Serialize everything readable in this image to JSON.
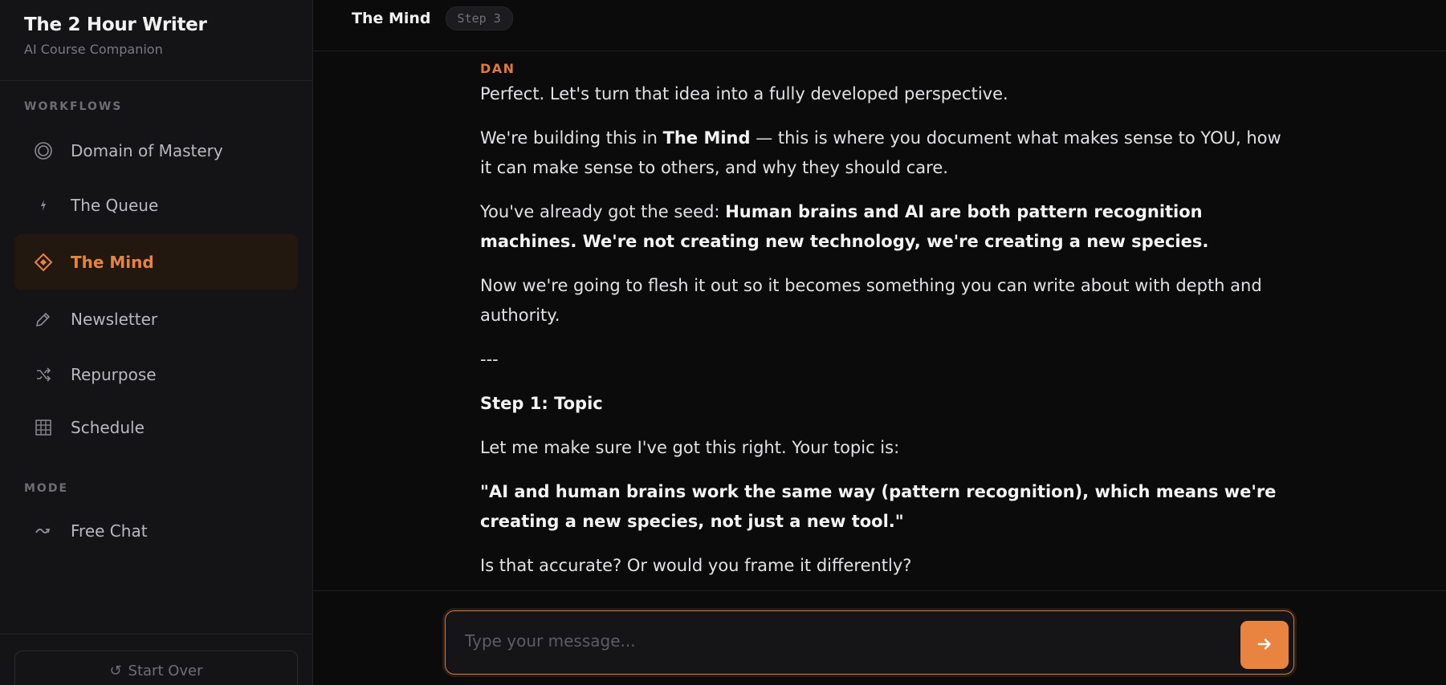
{
  "sidebar": {
    "brand_title": "The 2 Hour Writer",
    "brand_subtitle": "AI Course Companion",
    "workflows_label": "WORKFLOWS",
    "items": [
      {
        "label": "Domain of Mastery",
        "icon": "target-rings-icon"
      },
      {
        "label": "The Queue",
        "icon": "lightning-icon"
      },
      {
        "label": "The Mind",
        "icon": "diamond-icon",
        "active": true
      },
      {
        "label": "Newsletter",
        "icon": "pencil-icon"
      },
      {
        "label": "Repurpose",
        "icon": "shuffle-icon"
      },
      {
        "label": "Schedule",
        "icon": "grid-icon"
      }
    ],
    "mode_label": "MODE",
    "mode_items": [
      {
        "label": "Free Chat",
        "icon": "wave-icon"
      }
    ],
    "start_over": "Start Over"
  },
  "header": {
    "title": "The Mind",
    "step": "Step 3"
  },
  "message": {
    "sender": "DAN",
    "p1": "Perfect. Let's turn that idea into a fully developed perspective.",
    "p2_a": "We're building this in ",
    "p2_b": "The Mind",
    "p2_c": " — this is where you document what makes sense to YOU, how it can make sense to others, and why they should care.",
    "p3_a": "You've already got the seed: ",
    "p3_b": "Human brains and AI are both pattern recognition machines. We're not creating new technology, we're creating a new species.",
    "p4": "Now we're going to flesh it out so it becomes something you can write about with depth and authority.",
    "divider": "---",
    "step_heading": "Step 1: Topic",
    "p5": "Let me make sure I've got this right. Your topic is:",
    "quote": "\"AI and human brains work the same way (pattern recognition), which means we're creating a new species, not just a new tool.\"",
    "p6": "Is that accurate? Or would you frame it differently?"
  },
  "composer": {
    "placeholder": "Type your message...",
    "value": ""
  },
  "colors": {
    "accent": "#e8843f",
    "background": "#0b0b0c",
    "sidebar": "#141416"
  }
}
